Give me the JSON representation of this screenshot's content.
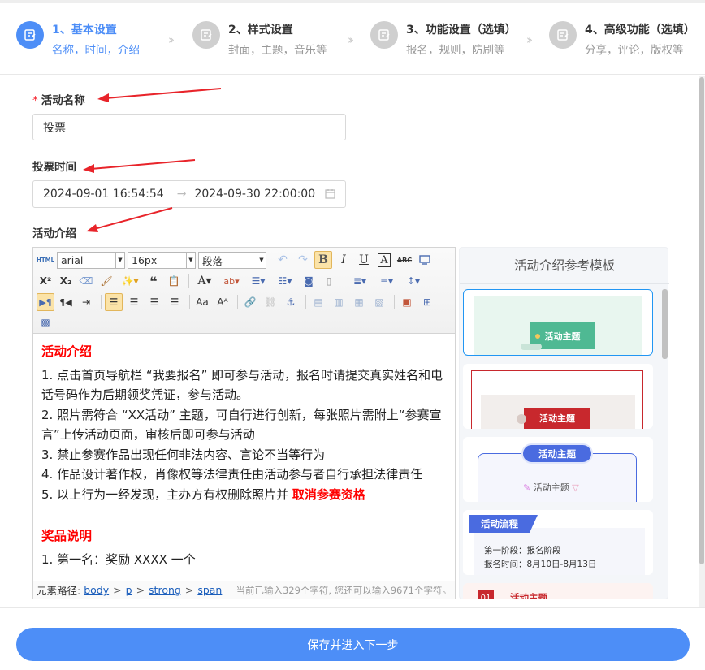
{
  "steps": [
    {
      "title": "1、基本设置",
      "sub": "名称，时间，介绍"
    },
    {
      "title": "2、样式设置",
      "sub": "封面，主题，音乐等"
    },
    {
      "title": "3、功能设置（选填）",
      "sub": "报名，规则，防刷等"
    },
    {
      "title": "4、高级功能（选填）",
      "sub": "分享，评论，版权等"
    }
  ],
  "form": {
    "name_label": "活动名称",
    "name_required_mark": "*",
    "name_value": "投票",
    "time_label": "投票时间",
    "time_start": "2024-09-01 16:54:54",
    "time_sep": "→",
    "time_end": "2024-09-30 22:00:00",
    "intro_label": "活动介绍"
  },
  "editor": {
    "html_tag": "HTML",
    "font_family": "arial",
    "font_size": "16px",
    "paragraph": "段落",
    "content": {
      "heading": "活动介绍",
      "items": [
        "1. 点击首页导航栏 “我要报名” 即可参与活动，报名时请提交真实姓名和电话号码作为后期领奖凭证，参与活动。",
        "2. 照片需符合 “XX活动” 主题，可自行进行创新，每张照片需附上“参赛宣言”上传活动页面，审核后即可参与活动",
        "3. 禁止参赛作品出现任何非法内容、言论不当等行为",
        "4. 作品设计著作权，肖像权等法律责任由活动参与者自行承担法律责任"
      ],
      "item5_prefix": "5. 以上行为一经发现，主办方有权删除照片并",
      "item5_highlight": "取消参赛资格",
      "prize_heading": "奖品说明",
      "prize_line": "1. 第一名：奖励 XXXX 一个"
    },
    "path_label": "元素路径:",
    "path": [
      "body",
      "p",
      "strong",
      "span"
    ],
    "path_sep": ">",
    "char_count": "当前已输入329个字符, 您还可以输入9671个字符。"
  },
  "templates": {
    "title": "活动介绍参考模板",
    "card_tags": [
      "活动主题",
      "活动主题",
      "活动主题",
      "活动主题"
    ],
    "flow_title": "活动流程",
    "flow_line1": "第一阶段：报名阶段",
    "flow_line2": "报名时间：8月10日-8月13日",
    "card5_num": "01",
    "card5_tag": "活动主题"
  },
  "footer": {
    "save_label": "保存并进入下一步"
  },
  "colors": {
    "primary": "#4d8ef7",
    "required": "#f5222d",
    "annotation_arrow": "#e8242a"
  }
}
